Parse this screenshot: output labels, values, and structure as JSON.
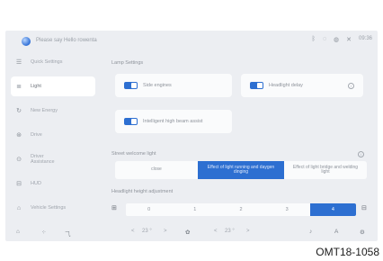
{
  "header": {
    "welcome": "Please say Hello rowenta",
    "icons": [
      "bluetooth-icon",
      "signal-icon",
      "wifi-icon",
      "close-icon"
    ],
    "clock": "09:36"
  },
  "sidebar": {
    "items": [
      {
        "label": "Quick Settings",
        "icon": "quick-settings-icon"
      },
      {
        "label": "Light",
        "icon": "light-icon"
      },
      {
        "label": "New Energy",
        "icon": "energy-icon"
      },
      {
        "label": "Drive",
        "icon": "drive-icon"
      },
      {
        "label": "Driver Assistance",
        "icon": "driver-assistance-icon"
      },
      {
        "label": "HUD",
        "icon": "hud-icon"
      },
      {
        "label": "Vehicle Settings",
        "icon": "vehicle-settings-icon"
      }
    ],
    "active_index": 1
  },
  "main": {
    "lamp_settings_title": "Lamp Settings",
    "lane_lights_label": "Side engines",
    "headlight_delay_label": "Headlight delay",
    "intelligent_beam_label": "Intelligent high beam assist",
    "street_lighting_title": "Street welcome light",
    "street_options": [
      {
        "label": "close"
      },
      {
        "label": "Effect of light running and daygen dinging"
      },
      {
        "label": "Effect of light bridge and welding light"
      }
    ],
    "street_selected": 1,
    "headlight_height_title": "Headlight height adjustment",
    "levels": [
      "0",
      "1",
      "2",
      "3",
      "4"
    ],
    "level_selected": 4
  },
  "dock": {
    "left_temp": "23 °",
    "right_temp": "23 °",
    "left_arrow": "<",
    "right_arrow": ">"
  },
  "caption": "OMT18-1058",
  "colors": {
    "accent": "#2d6fd1",
    "background": "#eceef2",
    "card": "#fafbfc"
  }
}
